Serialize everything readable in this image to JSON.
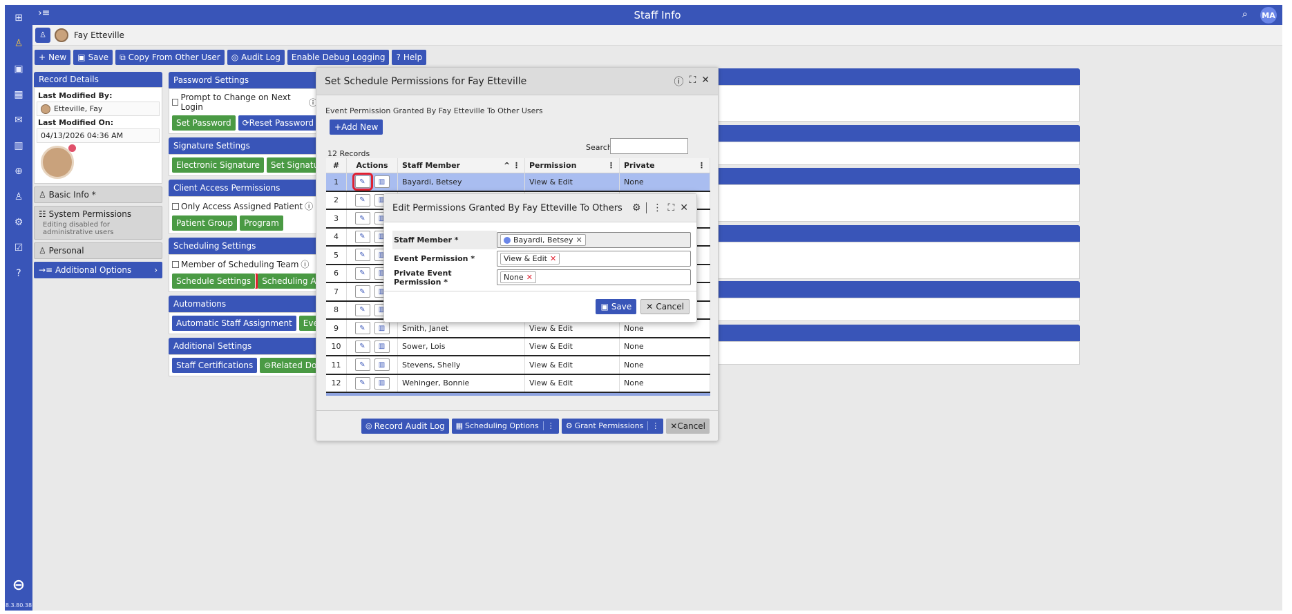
{
  "rail": {
    "version": "8.3.80.38"
  },
  "header": {
    "title": "Staff Info",
    "avatar": "MA"
  },
  "userbar": {
    "name": "Fay Etteville"
  },
  "toolbar": {
    "new": "New",
    "save": "Save",
    "copy": "Copy From Other User",
    "audit": "Audit Log",
    "debug": "Enable Debug Logging",
    "help": "Help"
  },
  "record": {
    "title": "Record Details",
    "modified_by_label": "Last Modified By:",
    "modified_by": "Etteville, Fay",
    "modified_on_label": "Last Modified On:",
    "modified_on": "04/13/2026 04:36 AM"
  },
  "nav": {
    "basic": "Basic Info *",
    "system": "System Permissions",
    "system_sub": "Editing disabled for administrative users",
    "personal": "Personal",
    "additional": "Additional Options"
  },
  "sections": {
    "password": {
      "title": "Password Settings",
      "check": "Prompt to Change on Next Login",
      "btn1": "Set Password",
      "btn2": "Reset Password"
    },
    "signature": {
      "title": "Signature Settings",
      "btn1": "Electronic Signature",
      "btn2": "Set Signature PIN"
    },
    "client": {
      "title": "Client Access Permissions",
      "check": "Only Access Assigned Patient",
      "btn1": "Patient Group",
      "btn2": "Program"
    },
    "scheduling": {
      "title": "Scheduling Settings",
      "check": "Member of Scheduling Team",
      "btn1": "Schedule Settings",
      "btn2": "Scheduling Availability"
    },
    "automations": {
      "title": "Automations",
      "btn1": "Automatic Staff Assignment",
      "btn2": "Event/Appointment"
    },
    "additional": {
      "title": "Additional Settings",
      "btn1": "Staff Certifications",
      "btn2": "Related Documents"
    }
  },
  "dialog1": {
    "title": "Set Schedule Permissions for Fay Etteville",
    "subtitle": "Event Permission Granted By Fay Etteville To Other Users",
    "add_new": "Add New",
    "records": "12 Records",
    "search_label": "Search:",
    "columns": [
      "#",
      "Actions",
      "Staff Member",
      "Permission",
      "Private"
    ],
    "rows": [
      {
        "n": "1",
        "staff": "Bayardi, Betsey",
        "perm": "View & Edit",
        "priv": "None"
      },
      {
        "n": "2",
        "staff": "",
        "perm": "",
        "priv": ""
      },
      {
        "n": "3",
        "staff": "",
        "perm": "",
        "priv": ""
      },
      {
        "n": "4",
        "staff": "",
        "perm": "",
        "priv": ""
      },
      {
        "n": "5",
        "staff": "",
        "perm": "",
        "priv": ""
      },
      {
        "n": "6",
        "staff": "",
        "perm": "",
        "priv": ""
      },
      {
        "n": "7",
        "staff": "",
        "perm": "",
        "priv": ""
      },
      {
        "n": "8",
        "staff": "",
        "perm": "",
        "priv": ""
      },
      {
        "n": "9",
        "staff": "Smith, Janet",
        "perm": "View & Edit",
        "priv": "None"
      },
      {
        "n": "10",
        "staff": "Sower, Lois",
        "perm": "View & Edit",
        "priv": "None"
      },
      {
        "n": "11",
        "staff": "Stevens, Shelly",
        "perm": "View & Edit",
        "priv": "None"
      },
      {
        "n": "12",
        "staff": "Wehinger, Bonnie",
        "perm": "View & Edit",
        "priv": "None"
      }
    ],
    "footer": {
      "audit": "Record Audit Log",
      "sched_options": "Scheduling Options",
      "grant": "Grant Permissions",
      "cancel": "Cancel"
    }
  },
  "dialog2": {
    "title": "Edit Permissions Granted By Fay Etteville To Others",
    "staff_label": "Staff Member *",
    "staff_value": "Bayardi, Betsey",
    "event_label": "Event Permission *",
    "event_value": "View & Edit",
    "private_label": "Private Event Permission *",
    "private_value": "None",
    "save": "Save",
    "cancel": "Cancel"
  }
}
